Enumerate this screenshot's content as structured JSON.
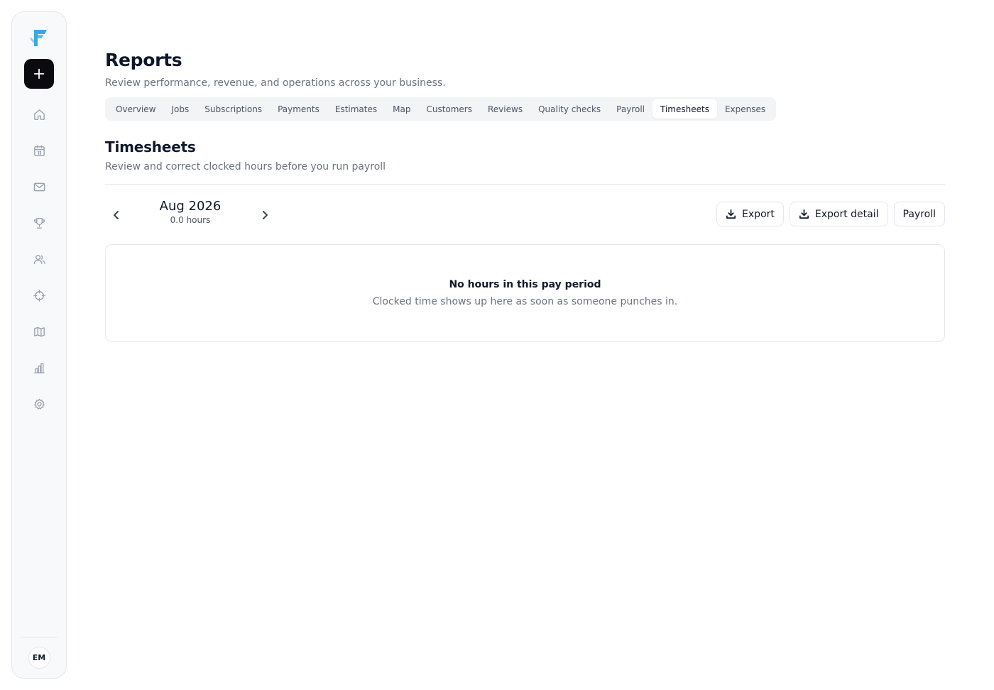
{
  "colors": {
    "accent": "#3aa8e8",
    "new_button": "#0b0b0f",
    "icon": "#9aa0ab"
  },
  "sidebar": {
    "logo_icon": "brand-f-icon",
    "new_icon": "plus-icon",
    "items": [
      {
        "id": "home",
        "icon": "home-icon"
      },
      {
        "id": "calendar",
        "icon": "calendar-icon"
      },
      {
        "id": "inbox",
        "icon": "mail-icon"
      },
      {
        "id": "rewards",
        "icon": "trophy-icon"
      },
      {
        "id": "team",
        "icon": "users-icon"
      },
      {
        "id": "targets",
        "icon": "crosshair-icon"
      },
      {
        "id": "map",
        "icon": "map-icon"
      },
      {
        "id": "reports",
        "icon": "bar-chart-icon"
      },
      {
        "id": "settings",
        "icon": "gear-icon"
      }
    ],
    "avatar_initials": "EM"
  },
  "header": {
    "title": "Reports",
    "subtitle": "Review performance, revenue, and operations across your business."
  },
  "tabs": [
    {
      "label": "Overview",
      "active": false
    },
    {
      "label": "Jobs",
      "active": false
    },
    {
      "label": "Subscriptions",
      "active": false
    },
    {
      "label": "Payments",
      "active": false
    },
    {
      "label": "Estimates",
      "active": false
    },
    {
      "label": "Map",
      "active": false
    },
    {
      "label": "Customers",
      "active": false
    },
    {
      "label": "Reviews",
      "active": false
    },
    {
      "label": "Quality checks",
      "active": false
    },
    {
      "label": "Payroll",
      "active": false
    },
    {
      "label": "Timesheets",
      "active": true
    },
    {
      "label": "Expenses",
      "active": false
    }
  ],
  "section": {
    "title": "Timesheets",
    "subtitle": "Review and correct clocked hours before you run payroll"
  },
  "period": {
    "label": "Aug 2026",
    "hours": "0.0 hours"
  },
  "actions": {
    "export_label": "Export",
    "export_detail_label": "Export detail",
    "payroll_label": "Payroll"
  },
  "empty_state": {
    "title": "No hours in this pay period",
    "text": "Clocked time shows up here as soon as someone punches in."
  }
}
